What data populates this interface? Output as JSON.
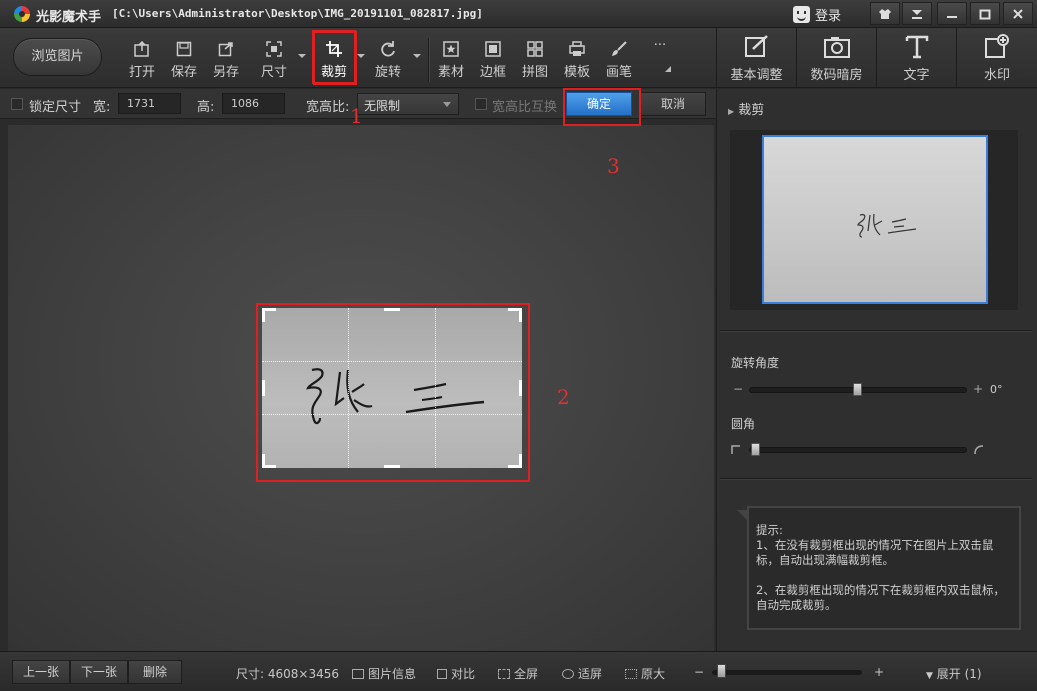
{
  "titlebar": {
    "app_name": "光影魔术手",
    "file_path": "[C:\\Users\\Administrator\\Desktop\\IMG_20191101_082817.jpg]",
    "login": "登录"
  },
  "toolbar": {
    "browse": "浏览图片",
    "tools": [
      "打开",
      "保存",
      "另存",
      "尺寸",
      "裁剪",
      "旋转",
      "素材",
      "边框",
      "拼图",
      "模板",
      "画笔"
    ],
    "more": "···",
    "right_tabs": [
      "基本调整",
      "数码暗房",
      "文字",
      "水印"
    ]
  },
  "cropbar": {
    "lock_size": "锁定尺寸",
    "width_label": "宽:",
    "width_value": "1731",
    "height_label": "高:",
    "height_value": "1086",
    "ratio_label": "宽高比:",
    "ratio_value": "无限制",
    "swap_ratio": "宽高比互换",
    "ok": "确定",
    "cancel": "取消"
  },
  "annotations": {
    "n1": "1",
    "n2": "2",
    "n3": "3"
  },
  "panel": {
    "title": "裁剪",
    "rotate_label": "旋转角度",
    "rotate_minus": "−",
    "rotate_plus": "+",
    "rotate_value": "0°",
    "round_label": "圆角",
    "tip": "提示:\n1、在没有裁剪框出现的情况下在图片上双击鼠标，自动出现满幅裁剪框。\n\n2、在裁剪框出现的情况下在裁剪框内双击鼠标，自动完成裁剪。"
  },
  "bottombar": {
    "prev": "上一张",
    "next": "下一张",
    "delete": "删除",
    "size": "尺寸: 4608×3456",
    "info": "图片信息",
    "compare": "对比",
    "fullscreen": "全屏",
    "fit": "适屏",
    "original": "原大",
    "zoom_minus": "−",
    "zoom_plus": "+",
    "expand": "展开 (1)"
  },
  "colors": {
    "accent_blue": "#2f80d8",
    "annotation_red": "#e02020"
  }
}
